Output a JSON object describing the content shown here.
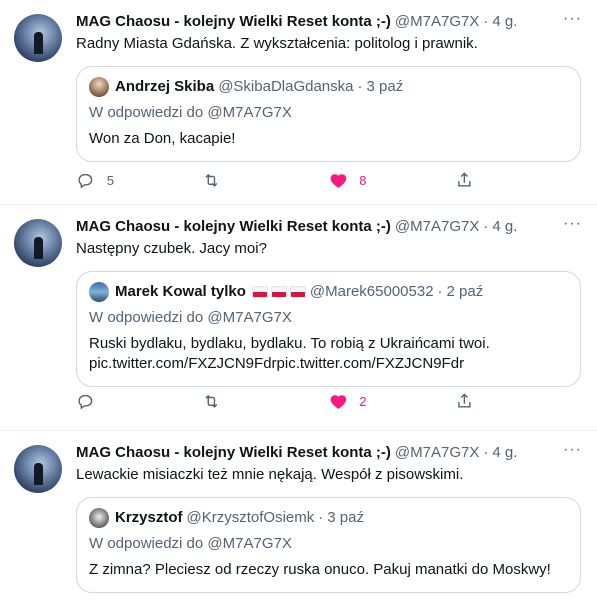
{
  "tweets": [
    {
      "author_name": "MAG Chaosu - kolejny Wielki Reset konta ;-)",
      "handle": "@M7A7G7X",
      "dot": "·",
      "time": "4 g.",
      "text": "Radny Miasta Gdańska. Z wykształcenia: politolog i prawnik.",
      "quote": {
        "name": "Andrzej Skiba",
        "handle": "@SkibaDlaGdanska",
        "dot": "·",
        "time": "3 paź",
        "reply_to_label": "W odpowiedzi do",
        "reply_to_handle": "@M7A7G7X",
        "text": "Won za Don, kacapie!"
      },
      "replies": "5",
      "retweets": "",
      "likes": "8"
    },
    {
      "author_name": "MAG Chaosu - kolejny Wielki Reset konta ;-)",
      "handle": "@M7A7G7X",
      "dot": "·",
      "time": "4 g.",
      "text": "Następny czubek. Jacy moi?",
      "quote": {
        "name": "Marek Kowal tylko",
        "handle": "@Marek65000532",
        "dot": "·",
        "time": "2 paź",
        "reply_to_label": "W odpowiedzi do",
        "reply_to_handle": "@M7A7G7X",
        "text_line1": "Ruski bydlaku, bydlaku, bydlaku. To robią z Ukraińcami twoi.",
        "text_line2": "pic.twitter.com/FXZJCN9Fdrpic.twitter.com/FXZJCN9Fdr"
      },
      "replies": "",
      "retweets": "",
      "likes": "2"
    },
    {
      "author_name": "MAG Chaosu - kolejny Wielki Reset konta ;-)",
      "handle": "@M7A7G7X",
      "dot": "·",
      "time": "4 g.",
      "text": "Lewackie misiaczki też mnie nękają. Wespół z pisowskimi.",
      "quote": {
        "name": "Krzysztof",
        "handle": "@KrzysztofOsiemk",
        "dot": "·",
        "time": "3 paź",
        "reply_to_label": "W odpowiedzi do",
        "reply_to_handle": "@M7A7G7X",
        "text": "Z zimna? Pleciesz od rzeczy ruska onuco. Pakuj manatki do Moskwy!"
      }
    }
  ],
  "icons": {
    "reply": "reply-icon",
    "retweet": "retweet-icon",
    "like": "heart-icon",
    "share": "share-icon",
    "more": "more-icon"
  },
  "colors": {
    "like_active": "#f91880",
    "secondary_text": "#536471",
    "border": "#cfd9de"
  }
}
